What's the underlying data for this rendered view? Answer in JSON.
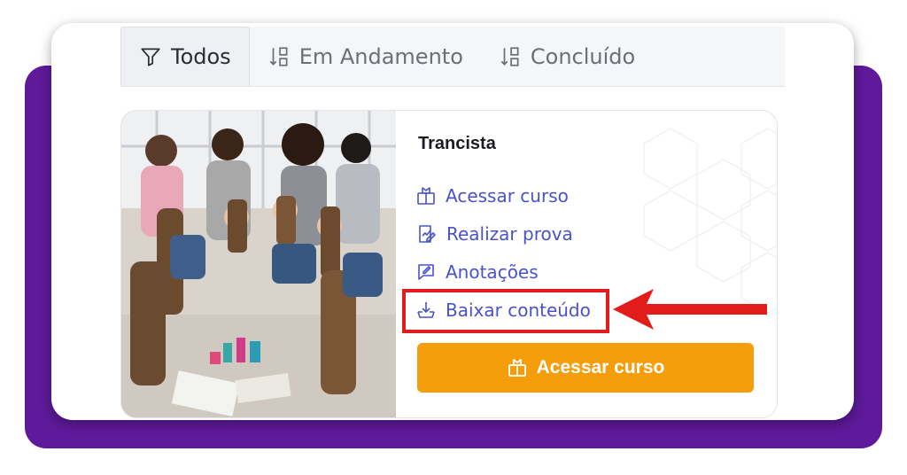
{
  "tabs": [
    {
      "label": "Todos",
      "icon": "filter-icon",
      "active": true
    },
    {
      "label": "Em Andamento",
      "icon": "sort-icon",
      "active": false
    },
    {
      "label": "Concluído",
      "icon": "sort-icon",
      "active": false
    }
  ],
  "course": {
    "title": "Trancista",
    "actions": [
      {
        "label": "Acessar curso",
        "icon": "book-open-icon"
      },
      {
        "label": "Realizar prova",
        "icon": "exam-icon"
      },
      {
        "label": "Anotações",
        "icon": "notes-icon"
      },
      {
        "label": "Baixar conteúdo",
        "icon": "download-icon"
      }
    ],
    "cta_label": "Acessar curso",
    "cta_icon": "book-open-icon"
  },
  "colors": {
    "purple_background": "#5e1a9a",
    "link_color": "#4a52c9",
    "cta_color": "#f59e0b",
    "annotation_red": "#e21b1b"
  }
}
